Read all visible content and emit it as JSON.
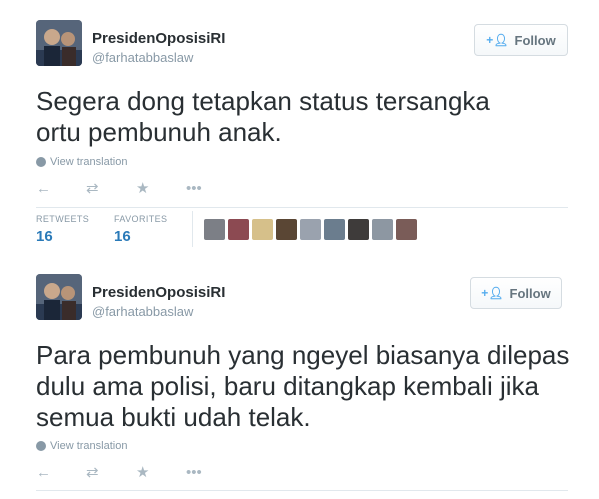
{
  "tweets": [
    {
      "fullname": "PresidenOposisiRI",
      "handle": "@farhatabbaslaw",
      "follow_label": "Follow",
      "text": "Segera dong tetapkan status tersangka ortu pembunuh anak.",
      "view_translation": "View translation",
      "stats": {
        "retweets_label": "RETWEETS",
        "retweets": "16",
        "favorites_label": "FAVORITES",
        "favorites": "16"
      }
    },
    {
      "fullname": "PresidenOposisiRI",
      "handle": "@farhatabbaslaw",
      "follow_label": "Follow",
      "text": "Para pembunuh yang ngeyel biasanya dilepas dulu ama polisi, baru ditangkap kembali jika semua bukti udah telak.",
      "view_translation": "View translation"
    }
  ],
  "icons": {
    "reply": "reply-icon",
    "retweet": "retweet-icon",
    "favorite": "star-icon",
    "more": "more-icon",
    "follow": "add-user-icon",
    "globe": "globe-icon"
  },
  "colors": {
    "accent": "#2a7ab8",
    "muted": "#8899a6",
    "icon": "#aab8c2"
  }
}
